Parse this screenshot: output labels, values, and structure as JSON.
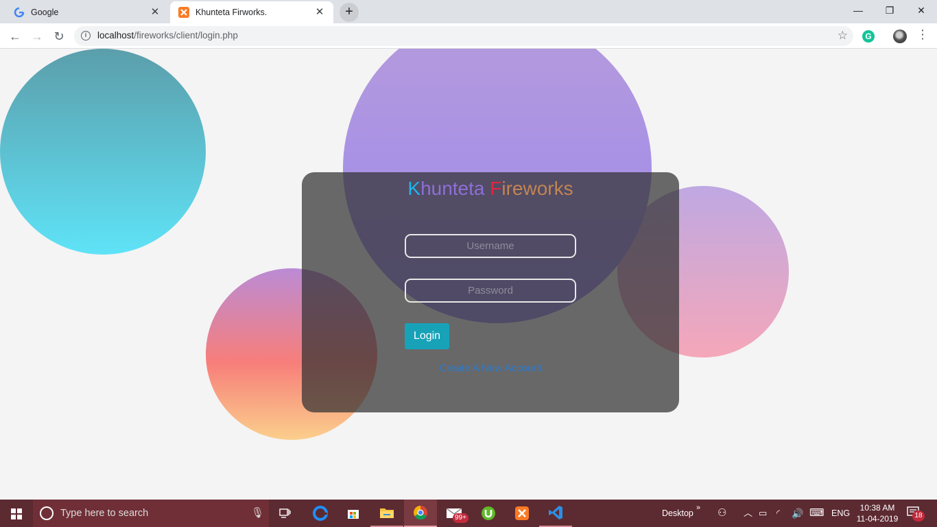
{
  "browser": {
    "tabs": [
      {
        "title": "Google",
        "active": false
      },
      {
        "title": "Khunteta Firworks.",
        "active": true
      }
    ],
    "new_tab_glyph": "+",
    "url_host": "localhost",
    "url_path": "/fireworks/client/login.php"
  },
  "page": {
    "brand_k": "K",
    "brand_rest1": "hunteta ",
    "brand_f": "F",
    "brand_rest2": "ireworks",
    "username_placeholder": "Username",
    "password_placeholder": "Password",
    "login_label": "Login",
    "signup_link": "Create A New Account",
    "colors": {
      "card": "#323232",
      "login_button": "#17a2b8",
      "link": "#2a7bd1"
    }
  },
  "taskbar": {
    "search_placeholder": "Type here to search",
    "desktop_label": "Desktop",
    "language": "ENG",
    "time": "10:38 AM",
    "date": "11-04-2019",
    "mail_badge": "99+",
    "notification_count": "18",
    "apps": [
      "edge-icon",
      "store-icon",
      "file-explorer-icon",
      "chrome-icon",
      "mail-icon",
      "utorrent-icon",
      "xampp-icon",
      "vscode-icon"
    ]
  }
}
